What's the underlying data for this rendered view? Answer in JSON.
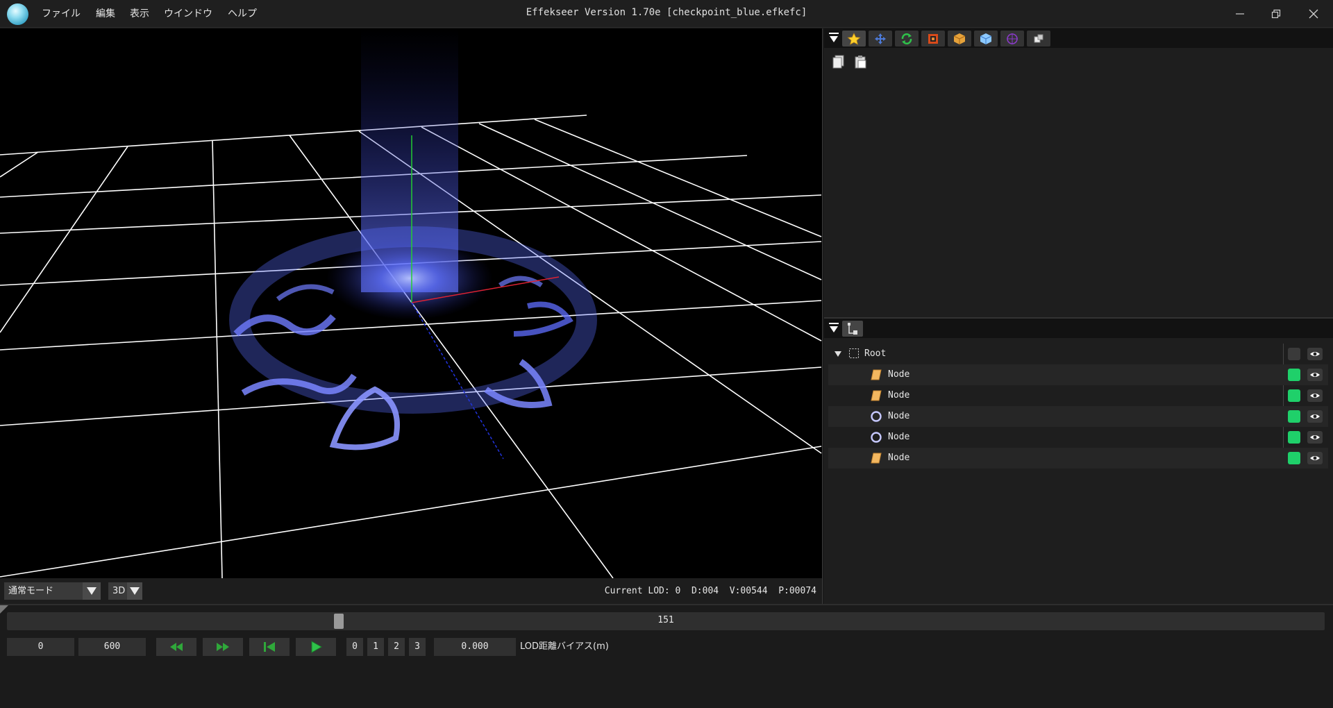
{
  "window": {
    "title": "Effekseer Version 1.70e [checkpoint_blue.efkefc]",
    "controls": [
      "minimize-icon",
      "restore-icon",
      "close-icon"
    ]
  },
  "menu": [
    "ファイル",
    "編集",
    "表示",
    "ウインドウ",
    "ヘルプ"
  ],
  "viewport": {
    "mode": "通常モード",
    "view": "3D",
    "stats": "Current LOD: 0  D:004  V:00544  P:00074"
  },
  "top_panel": {
    "tabs": [
      "star-icon",
      "move-icon",
      "refresh-icon",
      "stop-icon",
      "box-icon",
      "cube-icon",
      "target-icon",
      "blocks-icon"
    ],
    "actions": [
      "copy-icon",
      "paste-icon"
    ]
  },
  "tree_panel": {
    "tabs": [
      "node-tree-icon"
    ],
    "nodes": [
      {
        "label": "Root",
        "icon": "root-frame-icon",
        "level": 0,
        "visible": false
      },
      {
        "label": "Node",
        "icon": "sprite-node-icon",
        "level": 1,
        "visible": true
      },
      {
        "label": "Node",
        "icon": "sprite-node-icon",
        "level": 1,
        "visible": true
      },
      {
        "label": "Node",
        "icon": "ring-node-icon",
        "level": 1,
        "visible": true
      },
      {
        "label": "Node",
        "icon": "ring-node-icon",
        "level": 1,
        "visible": true
      },
      {
        "label": "Node",
        "icon": "sprite-node-icon",
        "level": 1,
        "visible": true
      }
    ]
  },
  "timeline": {
    "current_frame": "151",
    "current_frame_fraction": 0.25,
    "start_frame": "0",
    "end_frame": "600",
    "lod_buttons": [
      "0",
      "1",
      "2",
      "3"
    ],
    "lod_bias_value": "0.000",
    "lod_bias_label": "LOD距離バイアス(m)"
  },
  "colors": {
    "accent_green": "#1fd06a",
    "particle_blue": "#5a6cff"
  }
}
